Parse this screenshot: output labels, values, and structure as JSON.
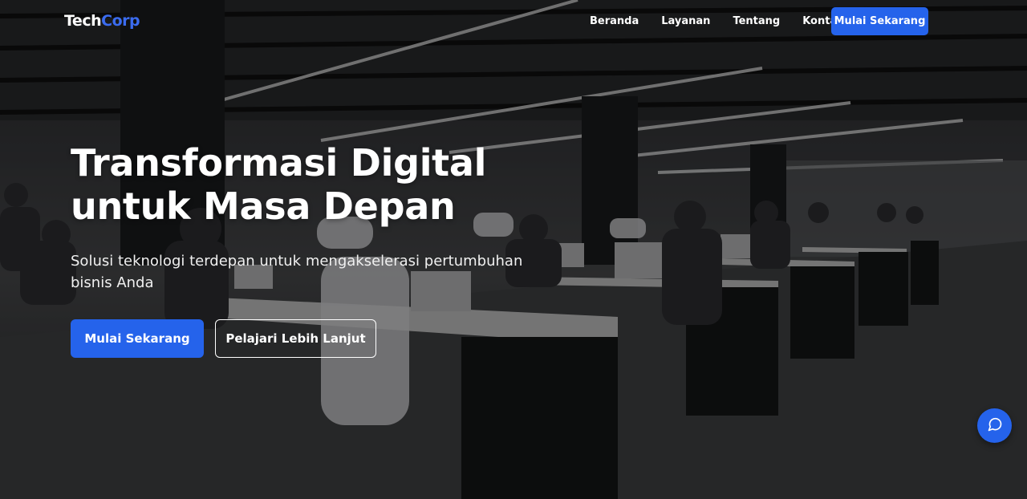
{
  "brand": {
    "name_part1": "Tech",
    "name_part2": "Corp",
    "accent": "#2563eb"
  },
  "nav": {
    "links": [
      "Beranda",
      "Layanan",
      "Tentang",
      "Kontak"
    ],
    "cta_label": "Mulai Sekarang"
  },
  "hero": {
    "title_line1": "Transformasi Digital",
    "title_line2": "untuk Masa Depan",
    "subtitle": "Solusi teknologi terdepan untuk mengakselerasi pertumbuhan bisnis Anda",
    "primary_button": "Mulai Sekarang",
    "secondary_button": "Pelajari Lebih Lanjut",
    "background": "office-photo"
  },
  "chat": {
    "icon": "chat-bubble-icon"
  }
}
